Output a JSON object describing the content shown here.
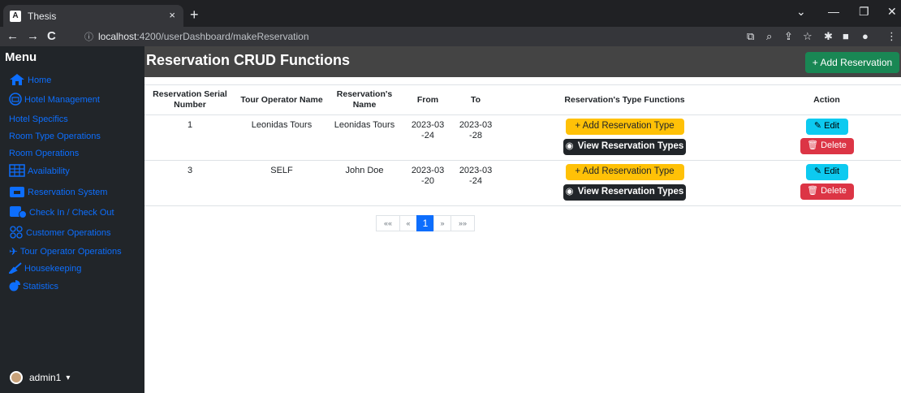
{
  "browser": {
    "tab_title": "Thesis",
    "tab_favicon": "A",
    "tab_close": "×",
    "new_tab": "+",
    "url_host": "localhost",
    "url_path": ":4200/userDashboard/makeReservation",
    "icons": [
      "back-icon",
      "forward-icon",
      "reload-icon",
      "info-icon",
      "translate-icon",
      "zoom-icon",
      "share-icon",
      "star-icon",
      "extensions-icon",
      "sidepanel-icon",
      "profile-icon",
      "kebab-menu-icon"
    ]
  },
  "sidebar": {
    "title": "Menu",
    "items": [
      {
        "label": "Home",
        "icon": "home-icon"
      },
      {
        "label": "Hotel Management",
        "icon": "hotel-icon"
      },
      {
        "label": "Hotel Specifics",
        "icon": ""
      },
      {
        "label": "Room Type Operations",
        "icon": ""
      },
      {
        "label": "Room Operations",
        "icon": ""
      },
      {
        "label": "Availability",
        "icon": "calendar-grid-icon"
      },
      {
        "label": "Reservation System",
        "icon": "reservation-icon"
      },
      {
        "label": "Check In / Check Out",
        "icon": "checkin-icon"
      },
      {
        "label": "Customer Operations",
        "icon": "customers-icon"
      },
      {
        "label": "Tour Operator Operations",
        "icon": "plane-icon"
      },
      {
        "label": "Housekeeping",
        "icon": "broom-icon"
      },
      {
        "label": "Statistics",
        "icon": "pie-chart-icon"
      }
    ],
    "user": "admin1"
  },
  "header": {
    "title": "Reservation CRUD Functions",
    "add_button": "+ Add Reservation"
  },
  "table": {
    "headers": [
      "Reservation Serial Number",
      "Tour Operator Name",
      "Reservation's Name",
      "From",
      "To",
      "Reservation's Type Functions",
      "Action"
    ],
    "rows": [
      {
        "serial": "1",
        "operator": "Leonidas Tours",
        "name": "Leonidas Tours",
        "from": "2023-03-24",
        "to": "2023-03-28"
      },
      {
        "serial": "3",
        "operator": "SELF",
        "name": "John Doe",
        "from": "2023-03-20",
        "to": "2023-03-24"
      }
    ],
    "add_type_label": "+ Add Reservation Type",
    "view_types_label": "View Reservation Types",
    "edit_label": "Edit",
    "delete_label": "Delete"
  },
  "pagination": {
    "first": "««",
    "prev": "«",
    "current": "1",
    "next": "»",
    "last": "»»"
  },
  "colors": {
    "sidebar_bg": "#212529",
    "link": "#0d6efd",
    "header_bg": "#444444",
    "success": "#198754",
    "warning": "#ffc107",
    "info": "#0dcaf0",
    "danger": "#dc3545"
  }
}
